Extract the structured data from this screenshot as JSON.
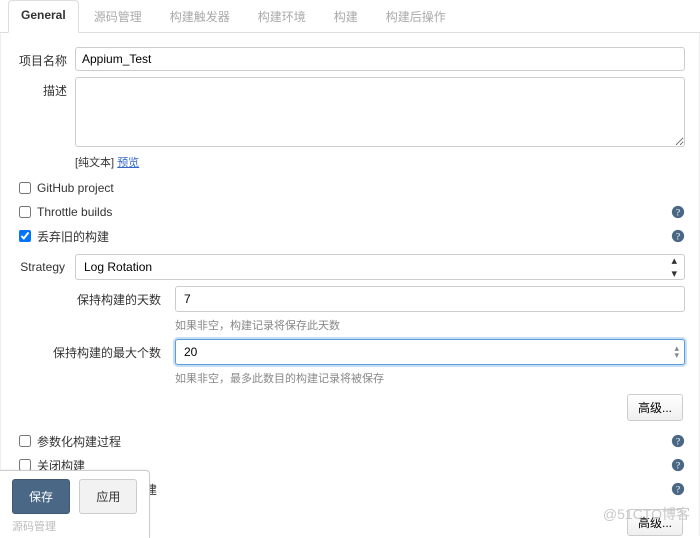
{
  "tabs": {
    "general": "General",
    "scm": "源码管理",
    "triggers": "构建触发器",
    "env": "构建环境",
    "build": "构建",
    "post": "构建后操作"
  },
  "labels": {
    "projectName": "项目名称",
    "description": "描述",
    "plaintext": "[纯文本]",
    "preview": "预览",
    "githubProject": "GitHub project",
    "throttleBuilds": "Throttle builds",
    "discardOld": "丢弃旧的构建",
    "strategy": "Strategy",
    "keepDays": "保持构建的天数",
    "keepDaysNote": "如果非空，构建记录将保存此天数",
    "keepMax": "保持构建的最大个数",
    "keepMaxNote": "如果非空，最多此数目的构建记录将被保存",
    "advanced": "高级...",
    "parameterized": "参数化构建过程",
    "disable": "关闭构建",
    "concurrent": "在必要的时候并发构建",
    "save": "保存",
    "apply": "应用",
    "faint": "源码管理",
    "watermark": "@51CTO博客"
  },
  "values": {
    "projectName": "Appium_Test",
    "description": "",
    "strategy": "Log Rotation",
    "keepDays": "7",
    "keepMax": "20"
  },
  "checks": {
    "github": false,
    "throttle": false,
    "discard": true,
    "parameterized": false,
    "disable": false,
    "concurrent": false
  }
}
